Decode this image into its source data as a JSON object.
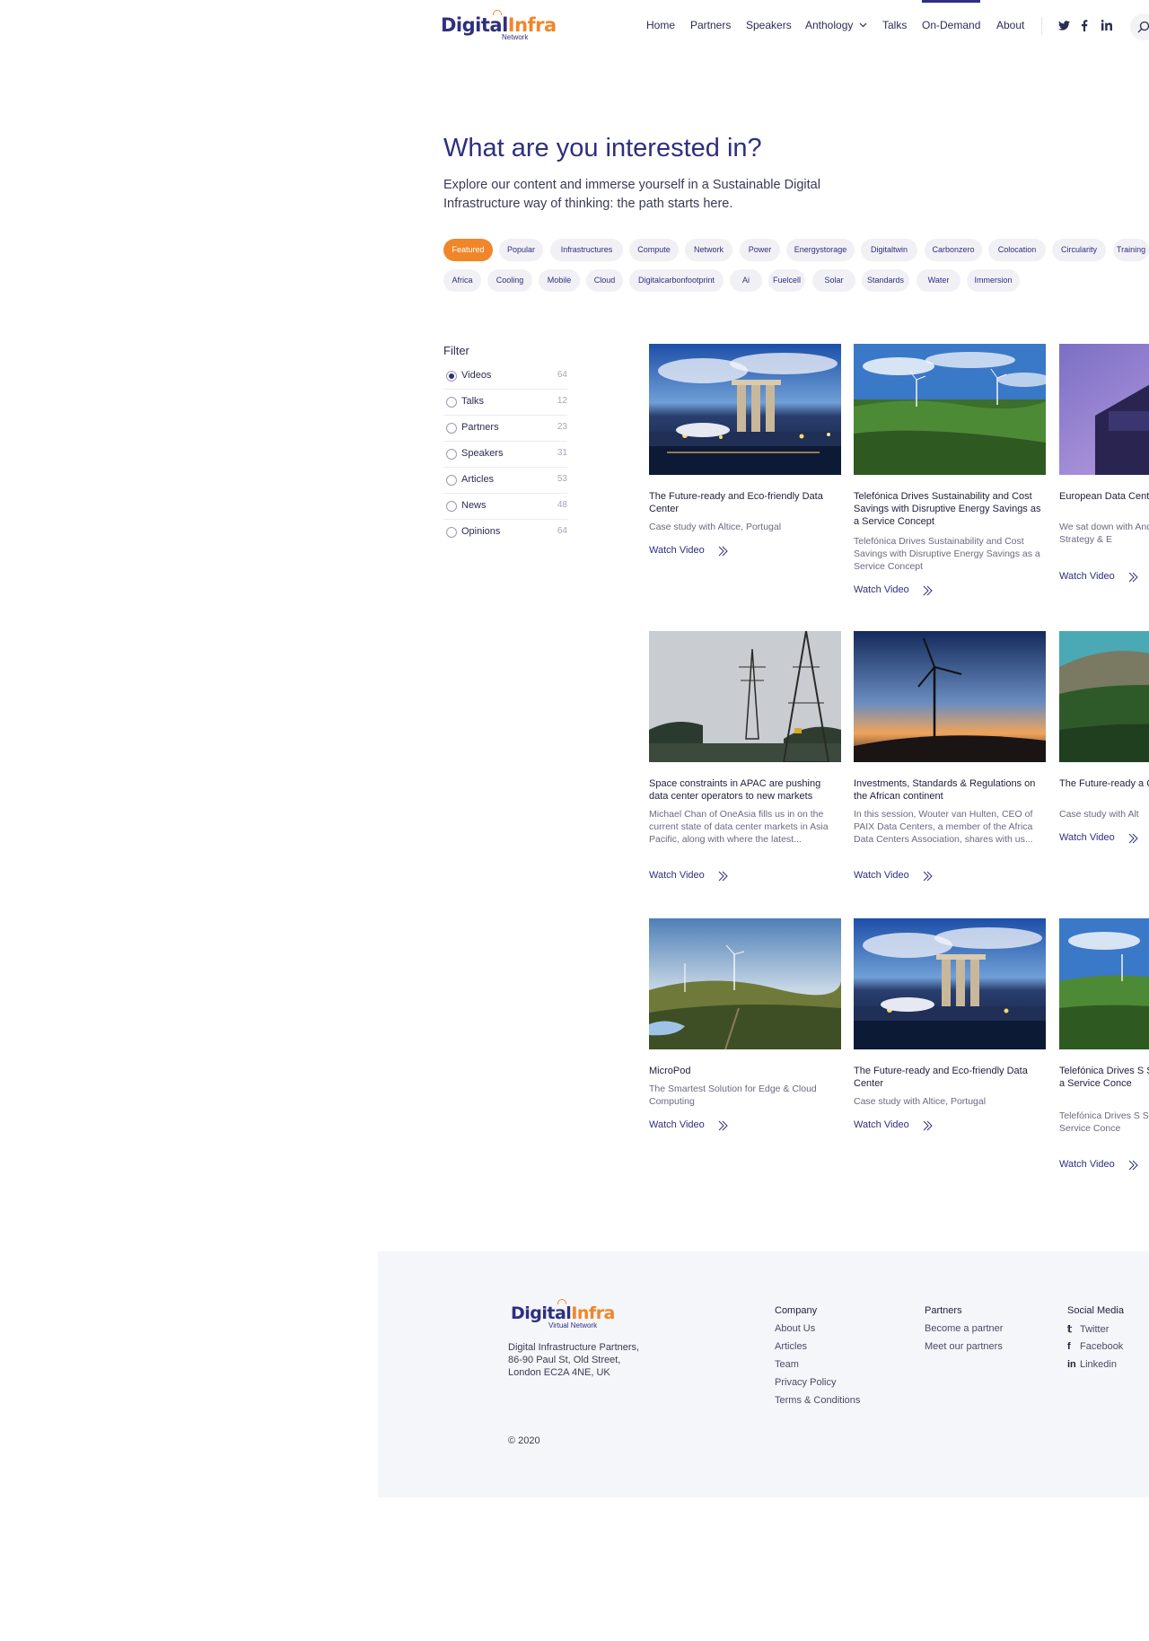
{
  "header": {
    "logo_main_a": "Digital",
    "logo_main_b": "Infra",
    "logo_sub": "Network",
    "nav": [
      "Home",
      "Partners",
      "Speakers",
      "Anthology",
      "Talks",
      "On-Demand",
      "About"
    ],
    "active_nav": "On-Demand",
    "social": [
      "twitter-icon",
      "facebook-icon",
      "linkedin-icon"
    ]
  },
  "hero": {
    "title": "What are you interested in?",
    "subtitle": "Explore our content and immerse yourself in a Sustainable Digital Infrastructure way of thinking: the path starts here."
  },
  "tags_row1": [
    "Featured",
    "Popular",
    "Infrastructures",
    "Compute",
    "Network",
    "Power",
    "Energystorage",
    "Digitaltwin",
    "Carbonzero",
    "Colocation",
    "Circularity",
    "Training"
  ],
  "tags_row2": [
    "Africa",
    "Cooling",
    "Mobile",
    "Cloud",
    "Digitalcarbonfootprint",
    "Ai",
    "Fuelcell",
    "Solar",
    "Standards",
    "Water",
    "Immersion"
  ],
  "active_tag": "Featured",
  "filter": {
    "title": "Filter",
    "items": [
      {
        "label": "Videos",
        "count": "64",
        "checked": true
      },
      {
        "label": "Talks",
        "count": "12",
        "checked": false
      },
      {
        "label": "Partners",
        "count": "23",
        "checked": false
      },
      {
        "label": "Speakers",
        "count": "31",
        "checked": false
      },
      {
        "label": "Articles",
        "count": "53",
        "checked": false
      },
      {
        "label": "News",
        "count": "48",
        "checked": false
      },
      {
        "label": "Opinions",
        "count": "64",
        "checked": false
      }
    ]
  },
  "cards": [
    {
      "title": "The Future-ready and Eco-friendly Data Center",
      "desc": "Case study with Altice, Portugal",
      "cta": "Watch Video",
      "image": "city-marina-night"
    },
    {
      "title": "Telefónica Drives Sustainability and Cost Savings with Disruptive Energy Savings as a Service Concept",
      "desc": "Telefónica Drives Sustainability and Cost Savings with Disruptive Energy Savings as a Service Concept",
      "cta": "Watch Video",
      "image": "wind-farm-forest"
    },
    {
      "title": "European Data Center CFO & EVP of Strat",
      "desc": "We sat down with Andy Power and G EVP of Strategy & E",
      "cta": "Watch Video",
      "image": "purple-building"
    },
    {
      "title": "Space constraints in APAC are pushing data center operators to new markets",
      "desc": "Michael Chan of OneAsia fills us in on the current state of data center markets in Asia Pacific, along with where the latest...",
      "cta": "Watch Video",
      "image": "power-pylons"
    },
    {
      "title": "Investments, Standards & Regulations on the African continent",
      "desc": "In this session, Wouter van Hulten, CEO of PAIX Data Centers, a member of the Africa Data Centers Association, shares with us...",
      "cta": "Watch Video",
      "image": "wind-turbine-sunset"
    },
    {
      "title": "The Future-ready a Center",
      "desc": "Case study with Alt",
      "cta": "Watch Video",
      "image": "mountain-forest"
    },
    {
      "title": "MicroPod",
      "desc": "The Smartest Solution for Edge & Cloud Computing",
      "cta": "Watch Video",
      "image": "wind-hills"
    },
    {
      "title": "The Future-ready and Eco-friendly Data Center",
      "desc": "Case study with Altice, Portugal",
      "cta": "Watch Video",
      "image": "city-marina-night"
    },
    {
      "title": "Telefónica Drives S Savings with Disrup as a Service Conce",
      "desc": "Telefónica Drives S Savings with Disrup as a Service Conce",
      "cta": "Watch Video",
      "image": "wind-farm-forest"
    }
  ],
  "footer": {
    "logo_main_a": "Digital",
    "logo_main_b": "Infra",
    "logo_sub": "Virtual Network",
    "address_l1": "Digital Infrastructure Partners,",
    "address_l2": "86-90 Paul St, Old Street,",
    "address_l3": "London EC2A 4NE, UK",
    "copyright": "© 2020",
    "company_title": "Company",
    "company_links": [
      "About Us",
      "Articles",
      "Team",
      "Privacy Policy",
      "Terms & Conditions"
    ],
    "partners_title": "Partners",
    "partners_links": [
      "Become a partner",
      "Meet our partners"
    ],
    "social_title": "Social Media",
    "social_links": [
      "Twitter",
      "Facebook",
      "Linkedin"
    ]
  },
  "colors": {
    "brand": "#2f2f7f",
    "accent": "#f0862a",
    "chip_bg": "#f1f1f5",
    "footer_bg": "#f5f6f9"
  }
}
